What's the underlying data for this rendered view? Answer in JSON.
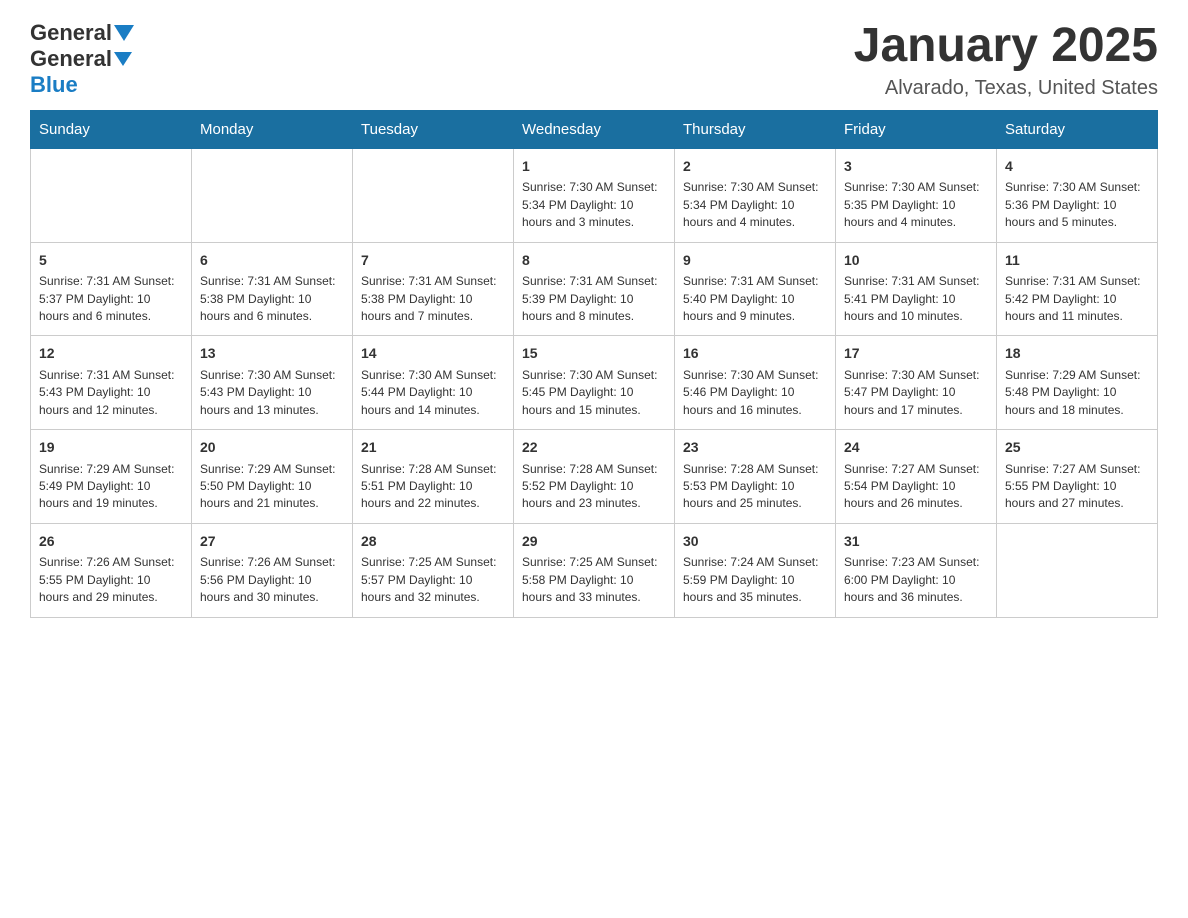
{
  "header": {
    "logo_general": "General",
    "logo_blue": "Blue",
    "month_title": "January 2025",
    "location": "Alvarado, Texas, United States"
  },
  "weekdays": [
    "Sunday",
    "Monday",
    "Tuesday",
    "Wednesday",
    "Thursday",
    "Friday",
    "Saturday"
  ],
  "weeks": [
    [
      {
        "day": "",
        "info": ""
      },
      {
        "day": "",
        "info": ""
      },
      {
        "day": "",
        "info": ""
      },
      {
        "day": "1",
        "info": "Sunrise: 7:30 AM\nSunset: 5:34 PM\nDaylight: 10 hours and 3 minutes."
      },
      {
        "day": "2",
        "info": "Sunrise: 7:30 AM\nSunset: 5:34 PM\nDaylight: 10 hours and 4 minutes."
      },
      {
        "day": "3",
        "info": "Sunrise: 7:30 AM\nSunset: 5:35 PM\nDaylight: 10 hours and 4 minutes."
      },
      {
        "day": "4",
        "info": "Sunrise: 7:30 AM\nSunset: 5:36 PM\nDaylight: 10 hours and 5 minutes."
      }
    ],
    [
      {
        "day": "5",
        "info": "Sunrise: 7:31 AM\nSunset: 5:37 PM\nDaylight: 10 hours and 6 minutes."
      },
      {
        "day": "6",
        "info": "Sunrise: 7:31 AM\nSunset: 5:38 PM\nDaylight: 10 hours and 6 minutes."
      },
      {
        "day": "7",
        "info": "Sunrise: 7:31 AM\nSunset: 5:38 PM\nDaylight: 10 hours and 7 minutes."
      },
      {
        "day": "8",
        "info": "Sunrise: 7:31 AM\nSunset: 5:39 PM\nDaylight: 10 hours and 8 minutes."
      },
      {
        "day": "9",
        "info": "Sunrise: 7:31 AM\nSunset: 5:40 PM\nDaylight: 10 hours and 9 minutes."
      },
      {
        "day": "10",
        "info": "Sunrise: 7:31 AM\nSunset: 5:41 PM\nDaylight: 10 hours and 10 minutes."
      },
      {
        "day": "11",
        "info": "Sunrise: 7:31 AM\nSunset: 5:42 PM\nDaylight: 10 hours and 11 minutes."
      }
    ],
    [
      {
        "day": "12",
        "info": "Sunrise: 7:31 AM\nSunset: 5:43 PM\nDaylight: 10 hours and 12 minutes."
      },
      {
        "day": "13",
        "info": "Sunrise: 7:30 AM\nSunset: 5:43 PM\nDaylight: 10 hours and 13 minutes."
      },
      {
        "day": "14",
        "info": "Sunrise: 7:30 AM\nSunset: 5:44 PM\nDaylight: 10 hours and 14 minutes."
      },
      {
        "day": "15",
        "info": "Sunrise: 7:30 AM\nSunset: 5:45 PM\nDaylight: 10 hours and 15 minutes."
      },
      {
        "day": "16",
        "info": "Sunrise: 7:30 AM\nSunset: 5:46 PM\nDaylight: 10 hours and 16 minutes."
      },
      {
        "day": "17",
        "info": "Sunrise: 7:30 AM\nSunset: 5:47 PM\nDaylight: 10 hours and 17 minutes."
      },
      {
        "day": "18",
        "info": "Sunrise: 7:29 AM\nSunset: 5:48 PM\nDaylight: 10 hours and 18 minutes."
      }
    ],
    [
      {
        "day": "19",
        "info": "Sunrise: 7:29 AM\nSunset: 5:49 PM\nDaylight: 10 hours and 19 minutes."
      },
      {
        "day": "20",
        "info": "Sunrise: 7:29 AM\nSunset: 5:50 PM\nDaylight: 10 hours and 21 minutes."
      },
      {
        "day": "21",
        "info": "Sunrise: 7:28 AM\nSunset: 5:51 PM\nDaylight: 10 hours and 22 minutes."
      },
      {
        "day": "22",
        "info": "Sunrise: 7:28 AM\nSunset: 5:52 PM\nDaylight: 10 hours and 23 minutes."
      },
      {
        "day": "23",
        "info": "Sunrise: 7:28 AM\nSunset: 5:53 PM\nDaylight: 10 hours and 25 minutes."
      },
      {
        "day": "24",
        "info": "Sunrise: 7:27 AM\nSunset: 5:54 PM\nDaylight: 10 hours and 26 minutes."
      },
      {
        "day": "25",
        "info": "Sunrise: 7:27 AM\nSunset: 5:55 PM\nDaylight: 10 hours and 27 minutes."
      }
    ],
    [
      {
        "day": "26",
        "info": "Sunrise: 7:26 AM\nSunset: 5:55 PM\nDaylight: 10 hours and 29 minutes."
      },
      {
        "day": "27",
        "info": "Sunrise: 7:26 AM\nSunset: 5:56 PM\nDaylight: 10 hours and 30 minutes."
      },
      {
        "day": "28",
        "info": "Sunrise: 7:25 AM\nSunset: 5:57 PM\nDaylight: 10 hours and 32 minutes."
      },
      {
        "day": "29",
        "info": "Sunrise: 7:25 AM\nSunset: 5:58 PM\nDaylight: 10 hours and 33 minutes."
      },
      {
        "day": "30",
        "info": "Sunrise: 7:24 AM\nSunset: 5:59 PM\nDaylight: 10 hours and 35 minutes."
      },
      {
        "day": "31",
        "info": "Sunrise: 7:23 AM\nSunset: 6:00 PM\nDaylight: 10 hours and 36 minutes."
      },
      {
        "day": "",
        "info": ""
      }
    ]
  ]
}
